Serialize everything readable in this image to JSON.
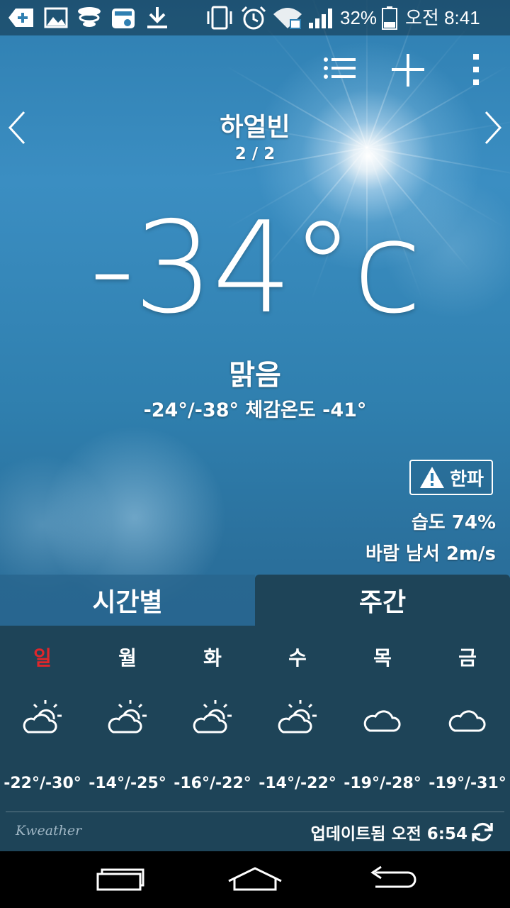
{
  "status_bar": {
    "battery_percent": "32%",
    "time": "오전 8:41",
    "icons": [
      "add-box-icon",
      "gallery-icon",
      "weather-app-icon",
      "store-icon",
      "download-icon",
      "vibrate-icon",
      "alarm-icon",
      "wifi-lock-icon",
      "signal-icon",
      "battery-icon"
    ]
  },
  "location": {
    "name": "하얼빈",
    "page": "2 / 2"
  },
  "current": {
    "temperature": "-34°c",
    "condition": "맑음",
    "minmax_feels": "-24°/-38° 체감온도 -41°",
    "alert_label": "한파",
    "humidity": "습도 74%",
    "wind": "바람 남서 2m/s"
  },
  "tabs": {
    "hourly": "시간별",
    "weekly": "주간"
  },
  "forecast": [
    {
      "day": "일",
      "icon": "partly-cloudy-icon",
      "range": "-22°/-30°",
      "color": "#e0262b"
    },
    {
      "day": "월",
      "icon": "partly-cloudy-icon",
      "range": "-14°/-25°",
      "color": "#ffffff"
    },
    {
      "day": "화",
      "icon": "partly-cloudy-icon",
      "range": "-16°/-22°",
      "color": "#ffffff"
    },
    {
      "day": "수",
      "icon": "partly-cloudy-icon",
      "range": "-14°/-22°",
      "color": "#ffffff"
    },
    {
      "day": "목",
      "icon": "cloud-icon",
      "range": "-19°/-28°",
      "color": "#ffffff"
    },
    {
      "day": "금",
      "icon": "cloud-icon",
      "range": "-19°/-31°",
      "color": "#ffffff"
    }
  ],
  "footer": {
    "provider": "Kweather",
    "updated": "업데이트됨 오전 6:54"
  }
}
